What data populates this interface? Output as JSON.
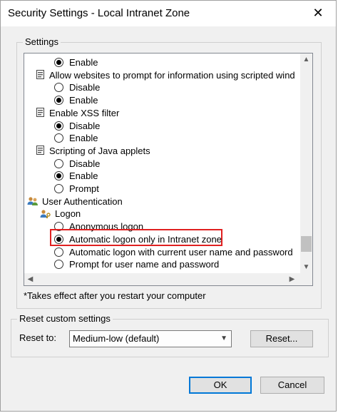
{
  "window": {
    "title": "Security Settings - Local Intranet Zone",
    "close_glyph": "✕"
  },
  "settings_group": {
    "label": "Settings"
  },
  "tree": [
    {
      "kind": "radio",
      "label": "Enable",
      "checked": true,
      "indent": 1
    },
    {
      "kind": "header",
      "label": "Allow websites to prompt for information using scripted wind",
      "icon": "settings-page-icon"
    },
    {
      "kind": "radio",
      "label": "Disable",
      "checked": false,
      "indent": 1
    },
    {
      "kind": "radio",
      "label": "Enable",
      "checked": true,
      "indent": 1
    },
    {
      "kind": "header",
      "label": "Enable XSS filter",
      "icon": "settings-page-icon"
    },
    {
      "kind": "radio",
      "label": "Disable",
      "checked": true,
      "indent": 1
    },
    {
      "kind": "radio",
      "label": "Enable",
      "checked": false,
      "indent": 1
    },
    {
      "kind": "header",
      "label": "Scripting of Java applets",
      "icon": "settings-page-icon"
    },
    {
      "kind": "radio",
      "label": "Disable",
      "checked": false,
      "indent": 1
    },
    {
      "kind": "radio",
      "label": "Enable",
      "checked": true,
      "indent": 1
    },
    {
      "kind": "radio",
      "label": "Prompt",
      "checked": false,
      "indent": 1
    },
    {
      "kind": "section",
      "label": "User Authentication",
      "icon": "users-icon"
    },
    {
      "kind": "header",
      "label": "Logon",
      "icon": "user-key-icon",
      "indent": 1
    },
    {
      "kind": "radio",
      "label": "Anonymous logon",
      "checked": false,
      "indent": 2
    },
    {
      "kind": "radio",
      "label": "Automatic logon only in Intranet zone",
      "checked": true,
      "indent": 2
    },
    {
      "kind": "radio",
      "label": "Automatic logon with current user name and password",
      "checked": false,
      "indent": 2
    },
    {
      "kind": "radio",
      "label": "Prompt for user name and password",
      "checked": false,
      "indent": 2
    }
  ],
  "scroll": {
    "vertical_position": 0.95,
    "horizontal_position": 0.0
  },
  "note": "*Takes effect after you restart your computer",
  "reset_group": {
    "label": "Reset custom settings",
    "reset_to_label": "Reset to:",
    "selected_level": "Medium-low (default)",
    "reset_button": "Reset..."
  },
  "buttons": {
    "ok": "OK",
    "cancel": "Cancel"
  },
  "colors": {
    "highlight": "#e02020",
    "default_button_border": "#0078d7"
  }
}
